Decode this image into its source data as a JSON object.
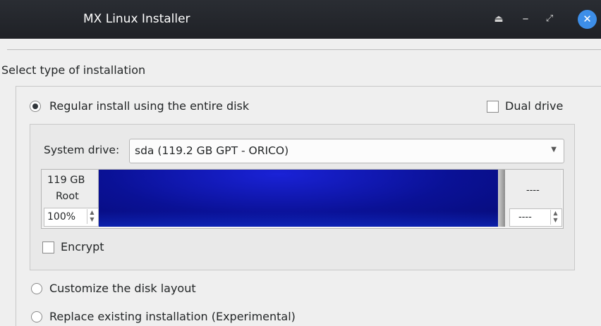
{
  "window": {
    "title": "MX Linux Installer",
    "controls": {
      "eject": "⏏",
      "minimize": "–",
      "maximize": "⤢",
      "close": "✕"
    }
  },
  "section_label": "Select type of installation",
  "options": {
    "regular": {
      "label": "Regular install using the entire disk",
      "selected": true
    },
    "customize": {
      "label": "Customize the disk layout",
      "selected": false
    },
    "replace": {
      "label": "Replace existing installation (Experimental)",
      "selected": false
    }
  },
  "dual_drive": {
    "label": "Dual drive",
    "checked": false
  },
  "system_drive": {
    "label": "System drive:",
    "value": "sda (119.2 GB GPT - ORICO)",
    "arrow": "▼"
  },
  "partition": {
    "size": "119 GB",
    "name": "Root",
    "percent": "100%",
    "right_size": "----",
    "right_percent": "----",
    "fill_fraction": 1.0
  },
  "encrypt": {
    "label": "Encrypt",
    "checked": false
  },
  "colors": {
    "bar": "#0a1196",
    "close_button": "#3d8ee8",
    "titlebar": "#1f2126"
  }
}
